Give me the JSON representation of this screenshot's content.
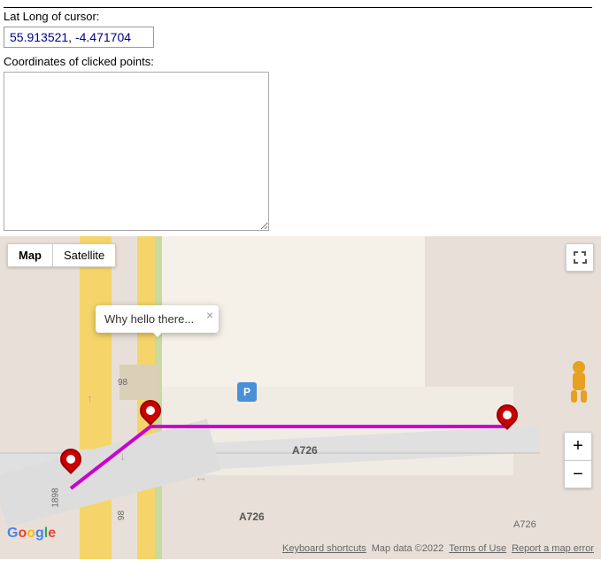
{
  "header": {
    "lat_long_label": "Lat Long of cursor:",
    "lat_long_value": "55.913521, -4.471704",
    "coords_label": "Coordinates of clicked points:"
  },
  "map": {
    "type_buttons": [
      {
        "label": "Map",
        "active": true
      },
      {
        "label": "Satellite",
        "active": false
      }
    ],
    "zoom_plus": "+",
    "zoom_minus": "−",
    "info_window_text": "Why hello there...",
    "info_close": "×",
    "road_labels": {
      "r1898": "1898",
      "r98a": "98",
      "r98b": "98",
      "a726_1": "A726",
      "a726_2": "A726",
      "a726_3": "A726"
    },
    "footer": {
      "keyboard": "Keyboard shortcuts",
      "map_data": "Map data ©2022",
      "terms": "Terms of Use",
      "report": "Report a map error"
    },
    "google_letters": [
      "G",
      "o",
      "o",
      "g",
      "l",
      "e"
    ]
  }
}
